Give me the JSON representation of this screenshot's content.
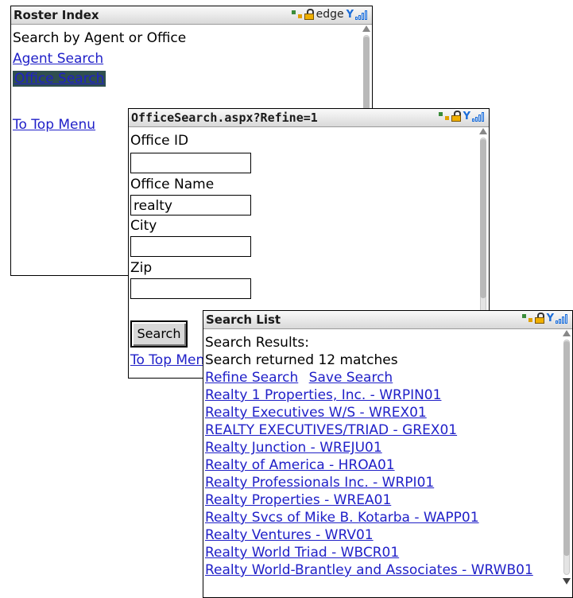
{
  "roster": {
    "title": "Roster Index",
    "network": "edge",
    "heading": "Search by Agent or Office",
    "agent_search": "Agent Search",
    "office_search": "Office Search",
    "top_menu": "To Top Menu"
  },
  "office": {
    "title": "OfficeSearch.aspx?Refine=1",
    "office_id_label": "Office ID",
    "office_id_value": "",
    "office_name_label": "Office Name",
    "office_name_value": "realty",
    "city_label": "City",
    "city_value": "",
    "zip_label": "Zip",
    "zip_value": "",
    "search_button": "Search",
    "top_menu": "To Top Menu"
  },
  "results": {
    "title": "Search List",
    "heading": "Search Results:",
    "summary": "Search returned 12 matches",
    "refine": "Refine Search",
    "save": "Save Search",
    "items": [
      "Realty 1 Properties, Inc. - WRPIN01",
      "Realty Executives W/S - WREX01",
      "REALTY EXECUTIVES/TRIAD - GREX01",
      "Realty Junction - WREJU01",
      "Realty of America - HROA01",
      "Realty Professionals Inc. - WRPI01",
      "Realty Properties - WREA01",
      "Realty Svcs of Mike B. Kotarba - WAPP01",
      "Realty Ventures - WRV01",
      "Realty World Triad - WBCR01",
      "Realty World-Brantley and Associates - WRWB01"
    ]
  },
  "icons": {
    "network": "network-icon",
    "lock": "lock-icon",
    "signal": "signal-strength-icon"
  }
}
